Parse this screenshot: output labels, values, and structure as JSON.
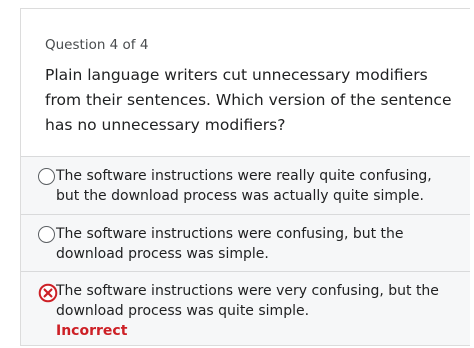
{
  "question": {
    "number_label": "Question 4 of 4",
    "prompt": "Plain language writers cut unnecessary modifiers from their sentences. Which version of the sentence has no unnecessary modifiers?"
  },
  "options": [
    {
      "text": "The software instructions were really quite confusing, but the download process was actually quite simple.",
      "icon": "radio-unselected-icon"
    },
    {
      "text": "The software instructions were confusing, but the download process was simple.",
      "icon": "radio-unselected-icon"
    },
    {
      "text": "The software instructions were very confusing, but the download process was quite simple.",
      "icon": "incorrect-x-icon",
      "feedback": "Incorrect"
    }
  ],
  "colors": {
    "incorrect": "#cd2026",
    "option_bg": "#f6f7f8",
    "text": "#202122"
  }
}
